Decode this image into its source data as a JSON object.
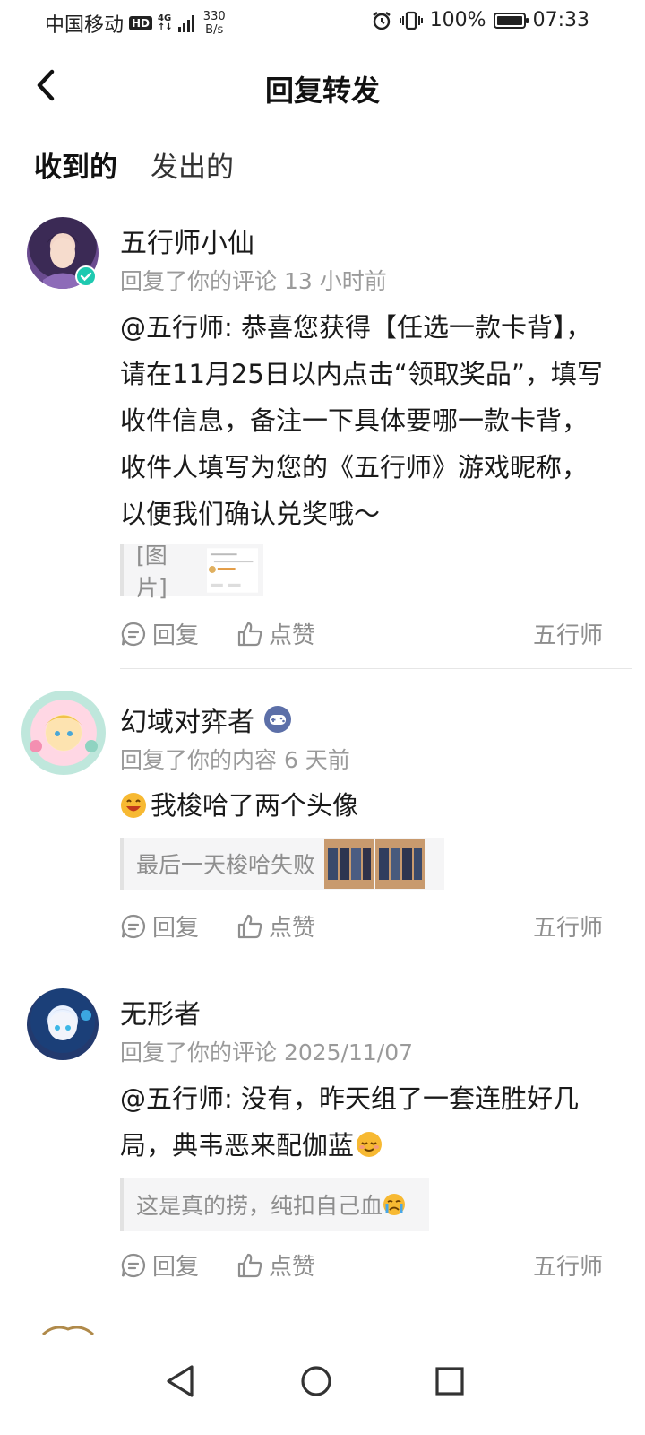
{
  "status_bar": {
    "carrier": "中国移动",
    "hd": "HD",
    "network_top": "4G",
    "network_bottom": "↑↓",
    "speed_value": "330",
    "speed_unit": "B/s",
    "battery": "100%",
    "time": "07:33",
    "battery_level": 1.0
  },
  "header": {
    "title": "回复转发"
  },
  "tabs": [
    {
      "label": "收到的",
      "active": true
    },
    {
      "label": "发出的",
      "active": false
    }
  ],
  "items": [
    {
      "name": "五行师小仙",
      "meta": "回复了你的评论 13 小时前",
      "text": "@五行师: 恭喜您获得【任选一款卡背】，请在11月25日以内点击“领取奖品”，填写收件信息，备注一下具体要哪一款卡背，收件人填写为您的《五行师》游戏昵称，以便我们确认兑奖哦～",
      "quote": "[图片]",
      "reply_label": "回复",
      "like_label": "点赞",
      "author": "五行师"
    },
    {
      "name": "幻域对弈者",
      "meta": "回复了你的内容 6 天前",
      "text": "我梭哈了两个头像",
      "quote": "最后一天梭哈失败",
      "reply_label": "回复",
      "like_label": "点赞",
      "author": "五行师"
    },
    {
      "name": "无形者",
      "meta": "回复了你的评论 2025/11/07",
      "text": "@五行师: 没有，昨天组了一套连胜好几局，典韦恶来配伽蓝",
      "quote": "这是真的捞，纯扣自己血",
      "reply_label": "回复",
      "like_label": "点赞",
      "author": "五行师"
    }
  ],
  "colors": {
    "accent": "#1ec9b0",
    "verified": "#1ec9b0",
    "muted_text": "#9a9a9a",
    "game_badge": "#5c6fa8"
  }
}
